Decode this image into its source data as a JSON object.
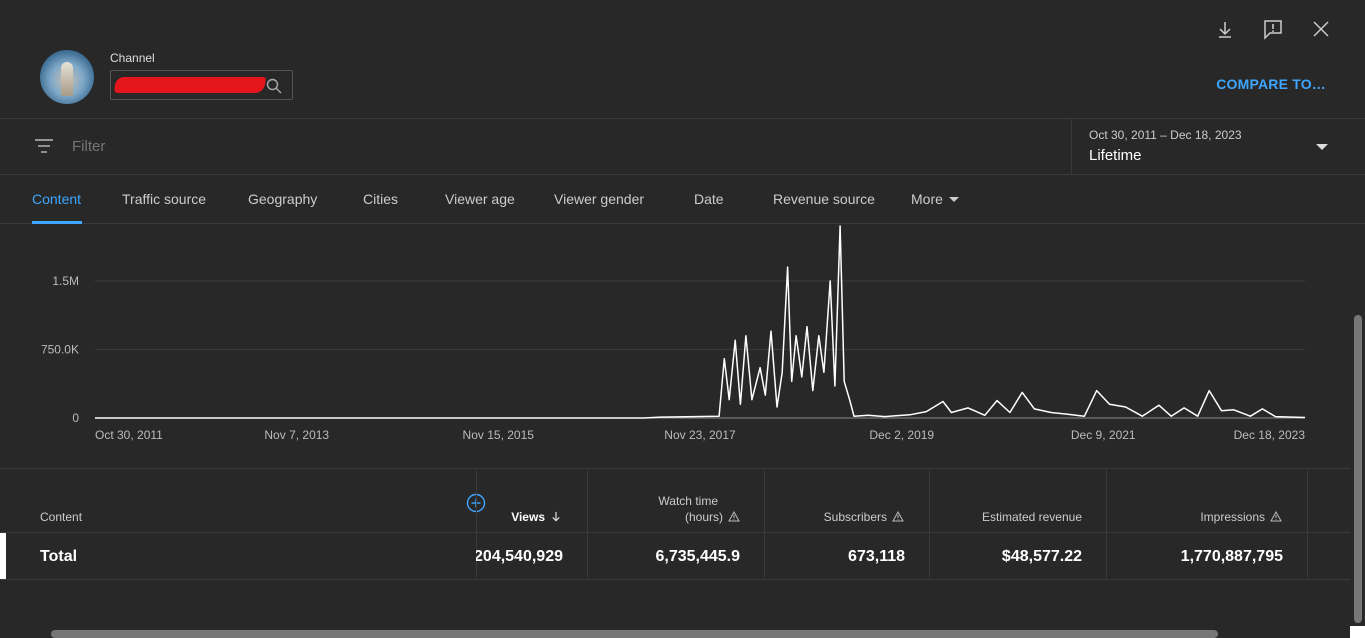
{
  "header": {
    "channel_label": "Channel",
    "compare_label": "COMPARE TO…"
  },
  "filter": {
    "placeholder": "Filter"
  },
  "date": {
    "range": "Oct 30, 2011 – Dec 18, 2023",
    "preset": "Lifetime"
  },
  "tabs": [
    {
      "label": "Content",
      "active": true
    },
    {
      "label": "Traffic source"
    },
    {
      "label": "Geography"
    },
    {
      "label": "Cities"
    },
    {
      "label": "Viewer age"
    },
    {
      "label": "Viewer gender"
    },
    {
      "label": "Date"
    },
    {
      "label": "Revenue source"
    },
    {
      "label": "More"
    }
  ],
  "chart_data": {
    "type": "line",
    "title": "",
    "xlabel": "",
    "ylabel": "",
    "y_ticks": [
      "1.5M",
      "750.0K",
      "0"
    ],
    "x_ticks": [
      "Oct 30, 2011",
      "Nov 7, 2013",
      "Nov 15, 2015",
      "Nov 23, 2017",
      "Dec 2, 2019",
      "Dec 9, 2021",
      "Dec 18, 2023"
    ],
    "ylim": [
      0,
      2100000
    ],
    "grid": true,
    "series": [
      {
        "values": [
          [
            "2011-10-30",
            0
          ],
          [
            "2017-05-01",
            0
          ],
          [
            "2017-07-01",
            10000
          ],
          [
            "2017-11-01",
            15000
          ],
          [
            "2018-02-01",
            20000
          ],
          [
            "2018-02-20",
            650000
          ],
          [
            "2018-03-10",
            200000
          ],
          [
            "2018-04-01",
            850000
          ],
          [
            "2018-04-20",
            150000
          ],
          [
            "2018-05-10",
            900000
          ],
          [
            "2018-06-01",
            200000
          ],
          [
            "2018-07-01",
            550000
          ],
          [
            "2018-07-20",
            250000
          ],
          [
            "2018-08-10",
            950000
          ],
          [
            "2018-09-01",
            120000
          ],
          [
            "2018-09-20",
            500000
          ],
          [
            "2018-10-10",
            1650000
          ],
          [
            "2018-10-25",
            400000
          ],
          [
            "2018-11-10",
            900000
          ],
          [
            "2018-12-01",
            450000
          ],
          [
            "2018-12-20",
            1000000
          ],
          [
            "2019-01-10",
            300000
          ],
          [
            "2019-02-01",
            900000
          ],
          [
            "2019-02-20",
            500000
          ],
          [
            "2019-03-15",
            1500000
          ],
          [
            "2019-04-01",
            350000
          ],
          [
            "2019-04-20",
            2100000
          ],
          [
            "2019-05-05",
            400000
          ],
          [
            "2019-05-25",
            200000
          ],
          [
            "2019-06-10",
            20000
          ],
          [
            "2019-08-01",
            30000
          ],
          [
            "2019-10-01",
            15000
          ],
          [
            "2020-01-01",
            35000
          ],
          [
            "2020-03-01",
            70000
          ],
          [
            "2020-05-01",
            180000
          ],
          [
            "2020-06-01",
            60000
          ],
          [
            "2020-08-01",
            110000
          ],
          [
            "2020-10-01",
            30000
          ],
          [
            "2020-11-15",
            190000
          ],
          [
            "2021-01-01",
            60000
          ],
          [
            "2021-02-15",
            280000
          ],
          [
            "2021-04-01",
            100000
          ],
          [
            "2021-06-01",
            60000
          ],
          [
            "2021-08-01",
            40000
          ],
          [
            "2021-10-01",
            20000
          ],
          [
            "2021-11-15",
            300000
          ],
          [
            "2022-01-01",
            150000
          ],
          [
            "2022-03-01",
            120000
          ],
          [
            "2022-05-01",
            20000
          ],
          [
            "2022-07-01",
            140000
          ],
          [
            "2022-08-15",
            20000
          ],
          [
            "2022-10-01",
            110000
          ],
          [
            "2022-11-20",
            20000
          ],
          [
            "2023-01-01",
            300000
          ],
          [
            "2023-02-15",
            80000
          ],
          [
            "2023-04-01",
            90000
          ],
          [
            "2023-06-01",
            20000
          ],
          [
            "2023-07-15",
            100000
          ],
          [
            "2023-09-01",
            15000
          ],
          [
            "2023-12-18",
            5000
          ]
        ]
      }
    ]
  },
  "table": {
    "headers": {
      "content": "Content",
      "views": "Views",
      "watch_time_1": "Watch time",
      "watch_time_2": "(hours)",
      "subscribers": "Subscribers",
      "revenue": "Estimated revenue",
      "impressions": "Impressions"
    },
    "total": {
      "label": "Total",
      "views": "204,540,929",
      "watch_time": "6,735,445.9",
      "subscribers": "673,118",
      "revenue": "$48,577.22",
      "impressions": "1,770,887,795"
    }
  },
  "icons": {
    "download": "download-icon",
    "feedback": "feedback-icon",
    "close": "close-icon",
    "search": "search-icon",
    "filter": "filter-icon",
    "add_column": "add-circle-icon",
    "warning": "warning-icon",
    "sort": "arrow-down-icon"
  },
  "colors": {
    "accent": "#3ea6ff",
    "background": "#282828",
    "line": "#ffffff"
  }
}
